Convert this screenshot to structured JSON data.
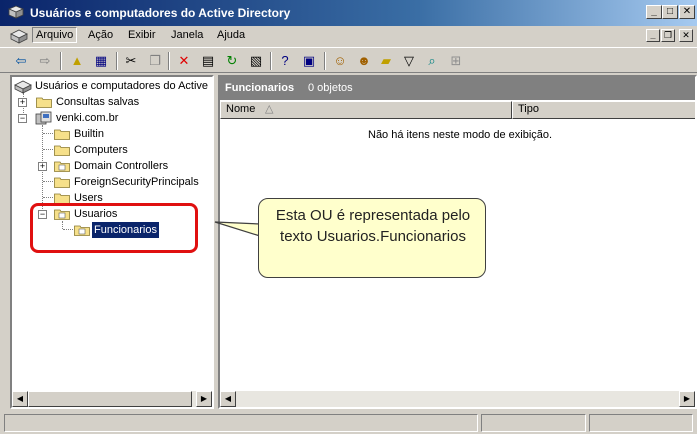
{
  "window": {
    "title": "Usuários e computadores do Active Directory",
    "min_label": "_",
    "max_label": "□",
    "close_label": "✕"
  },
  "menu": {
    "items": [
      "Arquivo",
      "Ação",
      "Exibir",
      "Janela",
      "Ajuda"
    ],
    "mdi_min": "_",
    "mdi_restore": "❐",
    "mdi_close": "✕"
  },
  "toolbar": {
    "icons": [
      "back-arrow-icon",
      "forward-arrow-icon",
      "up-folder-icon",
      "show-hide-tree-icon",
      "cut-icon",
      "copy-icon",
      "delete-icon",
      "properties-icon",
      "refresh-icon",
      "export-list-icon",
      "help-icon",
      "console-tree-icon",
      "new-user-icon",
      "new-group-icon",
      "new-ou-icon",
      "filter-icon",
      "find-icon",
      "add-to-group-icon"
    ]
  },
  "tree": {
    "root": "Usuários e computadores do Active D",
    "saved_queries": "Consultas salvas",
    "domain": "venki.com.br",
    "builtin": "Builtin",
    "computers": "Computers",
    "domain_controllers": "Domain Controllers",
    "foreign": "ForeignSecurityPrincipals",
    "users": "Users",
    "usuarios": "Usuarios",
    "funcionarios": "Funcionarios"
  },
  "details": {
    "title": "Funcionarios",
    "count": "0 objetos",
    "columns": [
      "Nome",
      "Tipo"
    ],
    "sort_indicator": "△",
    "empty_message": "Não há itens neste modo de exibição."
  },
  "annotation": {
    "line1": "Esta OU é representada pelo",
    "line2": "texto Usuarios.Funcionarios"
  },
  "colors": {
    "highlight": "#e01010",
    "callout_bg": "#ffffcc",
    "selection": "#0a246a"
  }
}
